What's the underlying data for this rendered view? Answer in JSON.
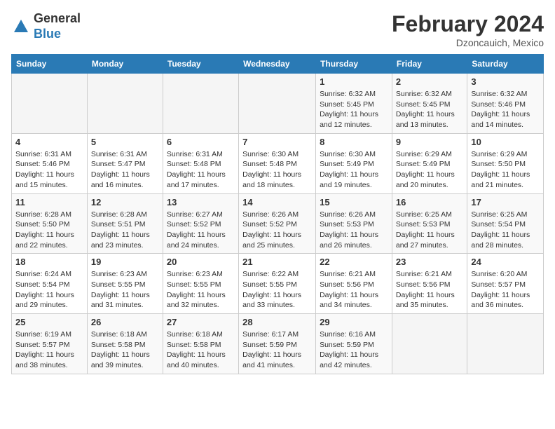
{
  "header": {
    "logo_line1": "General",
    "logo_line2": "Blue",
    "month_year": "February 2024",
    "location": "Dzoncauich, Mexico"
  },
  "weekdays": [
    "Sunday",
    "Monday",
    "Tuesday",
    "Wednesday",
    "Thursday",
    "Friday",
    "Saturday"
  ],
  "weeks": [
    [
      {
        "day": "",
        "info": ""
      },
      {
        "day": "",
        "info": ""
      },
      {
        "day": "",
        "info": ""
      },
      {
        "day": "",
        "info": ""
      },
      {
        "day": "1",
        "info": "Sunrise: 6:32 AM\nSunset: 5:45 PM\nDaylight: 11 hours and 12 minutes."
      },
      {
        "day": "2",
        "info": "Sunrise: 6:32 AM\nSunset: 5:45 PM\nDaylight: 11 hours and 13 minutes."
      },
      {
        "day": "3",
        "info": "Sunrise: 6:32 AM\nSunset: 5:46 PM\nDaylight: 11 hours and 14 minutes."
      }
    ],
    [
      {
        "day": "4",
        "info": "Sunrise: 6:31 AM\nSunset: 5:46 PM\nDaylight: 11 hours and 15 minutes."
      },
      {
        "day": "5",
        "info": "Sunrise: 6:31 AM\nSunset: 5:47 PM\nDaylight: 11 hours and 16 minutes."
      },
      {
        "day": "6",
        "info": "Sunrise: 6:31 AM\nSunset: 5:48 PM\nDaylight: 11 hours and 17 minutes."
      },
      {
        "day": "7",
        "info": "Sunrise: 6:30 AM\nSunset: 5:48 PM\nDaylight: 11 hours and 18 minutes."
      },
      {
        "day": "8",
        "info": "Sunrise: 6:30 AM\nSunset: 5:49 PM\nDaylight: 11 hours and 19 minutes."
      },
      {
        "day": "9",
        "info": "Sunrise: 6:29 AM\nSunset: 5:49 PM\nDaylight: 11 hours and 20 minutes."
      },
      {
        "day": "10",
        "info": "Sunrise: 6:29 AM\nSunset: 5:50 PM\nDaylight: 11 hours and 21 minutes."
      }
    ],
    [
      {
        "day": "11",
        "info": "Sunrise: 6:28 AM\nSunset: 5:50 PM\nDaylight: 11 hours and 22 minutes."
      },
      {
        "day": "12",
        "info": "Sunrise: 6:28 AM\nSunset: 5:51 PM\nDaylight: 11 hours and 23 minutes."
      },
      {
        "day": "13",
        "info": "Sunrise: 6:27 AM\nSunset: 5:52 PM\nDaylight: 11 hours and 24 minutes."
      },
      {
        "day": "14",
        "info": "Sunrise: 6:26 AM\nSunset: 5:52 PM\nDaylight: 11 hours and 25 minutes."
      },
      {
        "day": "15",
        "info": "Sunrise: 6:26 AM\nSunset: 5:53 PM\nDaylight: 11 hours and 26 minutes."
      },
      {
        "day": "16",
        "info": "Sunrise: 6:25 AM\nSunset: 5:53 PM\nDaylight: 11 hours and 27 minutes."
      },
      {
        "day": "17",
        "info": "Sunrise: 6:25 AM\nSunset: 5:54 PM\nDaylight: 11 hours and 28 minutes."
      }
    ],
    [
      {
        "day": "18",
        "info": "Sunrise: 6:24 AM\nSunset: 5:54 PM\nDaylight: 11 hours and 29 minutes."
      },
      {
        "day": "19",
        "info": "Sunrise: 6:23 AM\nSunset: 5:55 PM\nDaylight: 11 hours and 31 minutes."
      },
      {
        "day": "20",
        "info": "Sunrise: 6:23 AM\nSunset: 5:55 PM\nDaylight: 11 hours and 32 minutes."
      },
      {
        "day": "21",
        "info": "Sunrise: 6:22 AM\nSunset: 5:55 PM\nDaylight: 11 hours and 33 minutes."
      },
      {
        "day": "22",
        "info": "Sunrise: 6:21 AM\nSunset: 5:56 PM\nDaylight: 11 hours and 34 minutes."
      },
      {
        "day": "23",
        "info": "Sunrise: 6:21 AM\nSunset: 5:56 PM\nDaylight: 11 hours and 35 minutes."
      },
      {
        "day": "24",
        "info": "Sunrise: 6:20 AM\nSunset: 5:57 PM\nDaylight: 11 hours and 36 minutes."
      }
    ],
    [
      {
        "day": "25",
        "info": "Sunrise: 6:19 AM\nSunset: 5:57 PM\nDaylight: 11 hours and 38 minutes."
      },
      {
        "day": "26",
        "info": "Sunrise: 6:18 AM\nSunset: 5:58 PM\nDaylight: 11 hours and 39 minutes."
      },
      {
        "day": "27",
        "info": "Sunrise: 6:18 AM\nSunset: 5:58 PM\nDaylight: 11 hours and 40 minutes."
      },
      {
        "day": "28",
        "info": "Sunrise: 6:17 AM\nSunset: 5:59 PM\nDaylight: 11 hours and 41 minutes."
      },
      {
        "day": "29",
        "info": "Sunrise: 6:16 AM\nSunset: 5:59 PM\nDaylight: 11 hours and 42 minutes."
      },
      {
        "day": "",
        "info": ""
      },
      {
        "day": "",
        "info": ""
      }
    ]
  ]
}
